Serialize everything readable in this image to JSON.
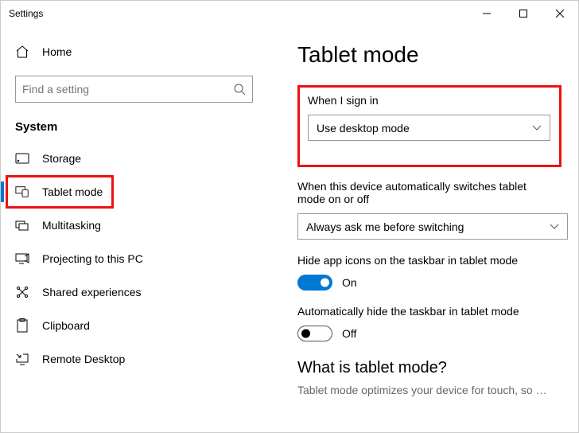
{
  "window": {
    "title": "Settings"
  },
  "sidebar": {
    "home": "Home",
    "search_placeholder": "Find a setting",
    "section": "System",
    "items": [
      {
        "label": "Storage"
      },
      {
        "label": "Tablet mode"
      },
      {
        "label": "Multitasking"
      },
      {
        "label": "Projecting to this PC"
      },
      {
        "label": "Shared experiences"
      },
      {
        "label": "Clipboard"
      },
      {
        "label": "Remote Desktop"
      }
    ]
  },
  "main": {
    "title": "Tablet mode",
    "signin_label": "When I sign in",
    "signin_value": "Use desktop mode",
    "autoswitch_label": "When this device automatically switches tablet mode on or off",
    "autoswitch_value": "Always ask me before switching",
    "hideicons_label": "Hide app icons on the taskbar in tablet mode",
    "hideicons_state": "On",
    "hidetaskbar_label": "Automatically hide the taskbar in tablet mode",
    "hidetaskbar_state": "Off",
    "whatis_title": "What is tablet mode?",
    "whatis_body": "Tablet mode optimizes your device for touch, so you"
  }
}
